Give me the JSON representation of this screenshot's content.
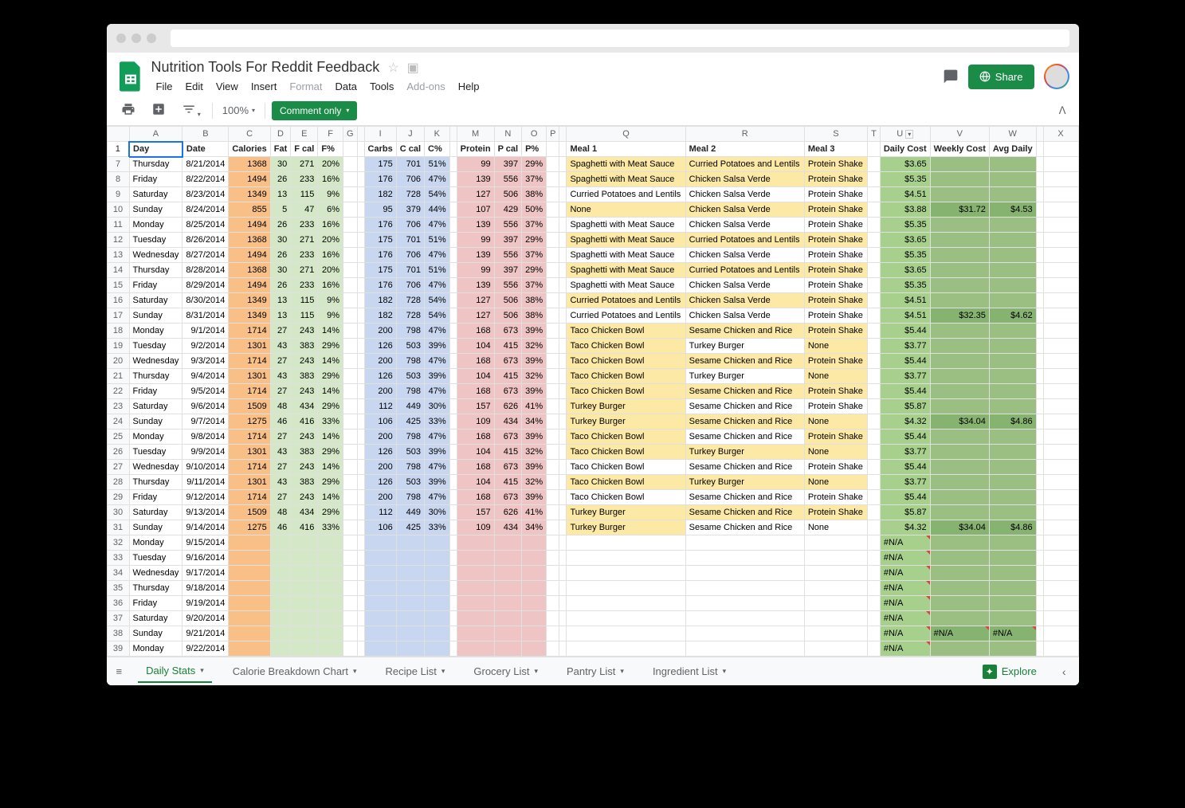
{
  "doc_title": "Nutrition Tools For Reddit Feedback",
  "menus": [
    "File",
    "Edit",
    "View",
    "Insert",
    "Format",
    "Data",
    "Tools",
    "Add-ons",
    "Help"
  ],
  "menu_disabled": [
    "Format",
    "Add-ons"
  ],
  "share_label": "Share",
  "zoom": "100%",
  "comment_mode": "Comment only",
  "columns_letters": [
    "A",
    "B",
    "C",
    "D",
    "E",
    "F",
    "G",
    "",
    "I",
    "J",
    "K",
    "",
    "M",
    "N",
    "O",
    "P",
    "",
    "Q",
    "R",
    "S",
    "T",
    "U",
    "V",
    "W",
    "",
    "X"
  ],
  "column_dropdown_idx": 21,
  "headers": [
    "Day",
    "Date",
    "Calories",
    "Fat",
    "F cal",
    "F%",
    "",
    "Carbs",
    "C cal",
    "C%",
    "",
    "Protein",
    "P cal",
    "P%",
    "",
    "Meal 1",
    "Meal 2",
    "Meal 3",
    "",
    "Daily Cost",
    "Weekly Cost",
    "Avg Daily",
    "",
    ""
  ],
  "first_row_num": 7,
  "rows": [
    {
      "n": 7,
      "day": "Thursday",
      "date": "8/21/2014",
      "cal": 1368,
      "fat": 30,
      "fcal": 271,
      "fp": "20%",
      "carb": 175,
      "ccal": 701,
      "cp": "51%",
      "pro": 99,
      "pcal": 397,
      "pp": "29%",
      "m1": "Spaghetti with Meat Sauce",
      "m2": "Curried Potatoes and Lentils",
      "m3": "Protein Shake",
      "dc": "$3.65",
      "wc": "",
      "avg": "",
      "h1": "y",
      "h2": "y",
      "h3": "y",
      "hc": ""
    },
    {
      "n": 8,
      "day": "Friday",
      "date": "8/22/2014",
      "cal": 1494,
      "fat": 26,
      "fcal": 233,
      "fp": "16%",
      "carb": 176,
      "ccal": 706,
      "cp": "47%",
      "pro": 139,
      "pcal": 556,
      "pp": "37%",
      "m1": "Spaghetti with Meat Sauce",
      "m2": "Chicken Salsa Verde",
      "m3": "Protein Shake",
      "dc": "$5.35",
      "wc": "",
      "avg": "",
      "h1": "y",
      "h2": "y",
      "h3": "y",
      "hc": ""
    },
    {
      "n": 9,
      "day": "Saturday",
      "date": "8/23/2014",
      "cal": 1349,
      "fat": 13,
      "fcal": 115,
      "fp": "9%",
      "carb": 182,
      "ccal": 728,
      "cp": "54%",
      "pro": 127,
      "pcal": 506,
      "pp": "38%",
      "m1": "Curried Potatoes and Lentils",
      "m2": "Chicken Salsa Verde",
      "m3": "Protein Shake",
      "dc": "$4.51",
      "wc": "",
      "avg": "",
      "h1": "",
      "h2": "",
      "h3": "",
      "hc": ""
    },
    {
      "n": 10,
      "day": "Sunday",
      "date": "8/24/2014",
      "cal": 855,
      "fat": 5,
      "fcal": 47,
      "fp": "6%",
      "carb": 95,
      "ccal": 379,
      "cp": "44%",
      "pro": 107,
      "pcal": 429,
      "pp": "50%",
      "m1": "None",
      "m2": "Chicken Salsa Verde",
      "m3": "Protein Shake",
      "dc": "$3.88",
      "wc": "$31.72",
      "avg": "$4.53",
      "h1": "y",
      "h2": "y",
      "h3": "y",
      "hc": "y"
    },
    {
      "n": 11,
      "day": "Monday",
      "date": "8/25/2014",
      "cal": 1494,
      "fat": 26,
      "fcal": 233,
      "fp": "16%",
      "carb": 176,
      "ccal": 706,
      "cp": "47%",
      "pro": 139,
      "pcal": 556,
      "pp": "37%",
      "m1": "Spaghetti with Meat Sauce",
      "m2": "Chicken Salsa Verde",
      "m3": "Protein Shake",
      "dc": "$5.35",
      "wc": "",
      "avg": "",
      "h1": "",
      "h2": "",
      "h3": "",
      "hc": ""
    },
    {
      "n": 12,
      "day": "Tuesday",
      "date": "8/26/2014",
      "cal": 1368,
      "fat": 30,
      "fcal": 271,
      "fp": "20%",
      "carb": 175,
      "ccal": 701,
      "cp": "51%",
      "pro": 99,
      "pcal": 397,
      "pp": "29%",
      "m1": "Spaghetti with Meat Sauce",
      "m2": "Curried Potatoes and Lentils",
      "m3": "Protein Shake",
      "dc": "$3.65",
      "wc": "",
      "avg": "",
      "h1": "y",
      "h2": "y",
      "h3": "y",
      "hc": ""
    },
    {
      "n": 13,
      "day": "Wednesday",
      "date": "8/27/2014",
      "cal": 1494,
      "fat": 26,
      "fcal": 233,
      "fp": "16%",
      "carb": 176,
      "ccal": 706,
      "cp": "47%",
      "pro": 139,
      "pcal": 556,
      "pp": "37%",
      "m1": "Spaghetti with Meat Sauce",
      "m2": "Chicken Salsa Verde",
      "m3": "Protein Shake",
      "dc": "$5.35",
      "wc": "",
      "avg": "",
      "h1": "",
      "h2": "",
      "h3": "",
      "hc": ""
    },
    {
      "n": 14,
      "day": "Thursday",
      "date": "8/28/2014",
      "cal": 1368,
      "fat": 30,
      "fcal": 271,
      "fp": "20%",
      "carb": 175,
      "ccal": 701,
      "cp": "51%",
      "pro": 99,
      "pcal": 397,
      "pp": "29%",
      "m1": "Spaghetti with Meat Sauce",
      "m2": "Curried Potatoes and Lentils",
      "m3": "Protein Shake",
      "dc": "$3.65",
      "wc": "",
      "avg": "",
      "h1": "y",
      "h2": "y",
      "h3": "y",
      "hc": ""
    },
    {
      "n": 15,
      "day": "Friday",
      "date": "8/29/2014",
      "cal": 1494,
      "fat": 26,
      "fcal": 233,
      "fp": "16%",
      "carb": 176,
      "ccal": 706,
      "cp": "47%",
      "pro": 139,
      "pcal": 556,
      "pp": "37%",
      "m1": "Spaghetti with Meat Sauce",
      "m2": "Chicken Salsa Verde",
      "m3": "Protein Shake",
      "dc": "$5.35",
      "wc": "",
      "avg": "",
      "h1": "",
      "h2": "",
      "h3": "",
      "hc": ""
    },
    {
      "n": 16,
      "day": "Saturday",
      "date": "8/30/2014",
      "cal": 1349,
      "fat": 13,
      "fcal": 115,
      "fp": "9%",
      "carb": 182,
      "ccal": 728,
      "cp": "54%",
      "pro": 127,
      "pcal": 506,
      "pp": "38%",
      "m1": "Curried Potatoes and Lentils",
      "m2": "Chicken Salsa Verde",
      "m3": "Protein Shake",
      "dc": "$4.51",
      "wc": "",
      "avg": "",
      "h1": "y",
      "h2": "y",
      "h3": "y",
      "hc": ""
    },
    {
      "n": 17,
      "day": "Sunday",
      "date": "8/31/2014",
      "cal": 1349,
      "fat": 13,
      "fcal": 115,
      "fp": "9%",
      "carb": 182,
      "ccal": 728,
      "cp": "54%",
      "pro": 127,
      "pcal": 506,
      "pp": "38%",
      "m1": "Curried Potatoes and Lentils",
      "m2": "Chicken Salsa Verde",
      "m3": "Protein Shake",
      "dc": "$4.51",
      "wc": "$32.35",
      "avg": "$4.62",
      "h1": "",
      "h2": "",
      "h3": "",
      "hc": "y"
    },
    {
      "n": 18,
      "day": "Monday",
      "date": "9/1/2014",
      "cal": 1714,
      "fat": 27,
      "fcal": 243,
      "fp": "14%",
      "carb": 200,
      "ccal": 798,
      "cp": "47%",
      "pro": 168,
      "pcal": 673,
      "pp": "39%",
      "m1": "Taco Chicken Bowl",
      "m2": "Sesame Chicken and Rice",
      "m3": "Protein Shake",
      "dc": "$5.44",
      "wc": "",
      "avg": "",
      "h1": "y",
      "h2": "y",
      "h3": "y",
      "hc": ""
    },
    {
      "n": 19,
      "day": "Tuesday",
      "date": "9/2/2014",
      "cal": 1301,
      "fat": 43,
      "fcal": 383,
      "fp": "29%",
      "carb": 126,
      "ccal": 503,
      "cp": "39%",
      "pro": 104,
      "pcal": 415,
      "pp": "32%",
      "m1": "Taco Chicken Bowl",
      "m2": "Turkey Burger",
      "m3": "None",
      "dc": "$3.77",
      "wc": "",
      "avg": "",
      "h1": "y",
      "h2": "",
      "h3": "y",
      "hc": ""
    },
    {
      "n": 20,
      "day": "Wednesday",
      "date": "9/3/2014",
      "cal": 1714,
      "fat": 27,
      "fcal": 243,
      "fp": "14%",
      "carb": 200,
      "ccal": 798,
      "cp": "47%",
      "pro": 168,
      "pcal": 673,
      "pp": "39%",
      "m1": "Taco Chicken Bowl",
      "m2": "Sesame Chicken and Rice",
      "m3": "Protein Shake",
      "dc": "$5.44",
      "wc": "",
      "avg": "",
      "h1": "y",
      "h2": "y",
      "h3": "y",
      "hc": ""
    },
    {
      "n": 21,
      "day": "Thursday",
      "date": "9/4/2014",
      "cal": 1301,
      "fat": 43,
      "fcal": 383,
      "fp": "29%",
      "carb": 126,
      "ccal": 503,
      "cp": "39%",
      "pro": 104,
      "pcal": 415,
      "pp": "32%",
      "m1": "Taco Chicken Bowl",
      "m2": "Turkey Burger",
      "m3": "None",
      "dc": "$3.77",
      "wc": "",
      "avg": "",
      "h1": "y",
      "h2": "",
      "h3": "y",
      "hc": ""
    },
    {
      "n": 22,
      "day": "Friday",
      "date": "9/5/2014",
      "cal": 1714,
      "fat": 27,
      "fcal": 243,
      "fp": "14%",
      "carb": 200,
      "ccal": 798,
      "cp": "47%",
      "pro": 168,
      "pcal": 673,
      "pp": "39%",
      "m1": "Taco Chicken Bowl",
      "m2": "Sesame Chicken and Rice",
      "m3": "Protein Shake",
      "dc": "$5.44",
      "wc": "",
      "avg": "",
      "h1": "y",
      "h2": "y",
      "h3": "y",
      "hc": ""
    },
    {
      "n": 23,
      "day": "Saturday",
      "date": "9/6/2014",
      "cal": 1509,
      "fat": 48,
      "fcal": 434,
      "fp": "29%",
      "carb": 112,
      "ccal": 449,
      "cp": "30%",
      "pro": 157,
      "pcal": 626,
      "pp": "41%",
      "m1": "Turkey Burger",
      "m2": "Sesame Chicken and Rice",
      "m3": "Protein Shake",
      "dc": "$5.87",
      "wc": "",
      "avg": "",
      "h1": "y",
      "h2": "",
      "h3": "",
      "hc": ""
    },
    {
      "n": 24,
      "day": "Sunday",
      "date": "9/7/2014",
      "cal": 1275,
      "fat": 46,
      "fcal": 416,
      "fp": "33%",
      "carb": 106,
      "ccal": 425,
      "cp": "33%",
      "pro": 109,
      "pcal": 434,
      "pp": "34%",
      "m1": "Turkey Burger",
      "m2": "Sesame Chicken and Rice",
      "m3": "None",
      "dc": "$4.32",
      "wc": "$34.04",
      "avg": "$4.86",
      "h1": "y",
      "h2": "y",
      "h3": "y",
      "hc": "y"
    },
    {
      "n": 25,
      "day": "Monday",
      "date": "9/8/2014",
      "cal": 1714,
      "fat": 27,
      "fcal": 243,
      "fp": "14%",
      "carb": 200,
      "ccal": 798,
      "cp": "47%",
      "pro": 168,
      "pcal": 673,
      "pp": "39%",
      "m1": "Taco Chicken Bowl",
      "m2": "Sesame Chicken and Rice",
      "m3": "Protein Shake",
      "dc": "$5.44",
      "wc": "",
      "avg": "",
      "h1": "y",
      "h2": "",
      "h3": "y",
      "hc": ""
    },
    {
      "n": 26,
      "day": "Tuesday",
      "date": "9/9/2014",
      "cal": 1301,
      "fat": 43,
      "fcal": 383,
      "fp": "29%",
      "carb": 126,
      "ccal": 503,
      "cp": "39%",
      "pro": 104,
      "pcal": 415,
      "pp": "32%",
      "m1": "Taco Chicken Bowl",
      "m2": "Turkey Burger",
      "m3": "None",
      "dc": "$3.77",
      "wc": "",
      "avg": "",
      "h1": "y",
      "h2": "y",
      "h3": "y",
      "hc": ""
    },
    {
      "n": 27,
      "day": "Wednesday",
      "date": "9/10/2014",
      "cal": 1714,
      "fat": 27,
      "fcal": 243,
      "fp": "14%",
      "carb": 200,
      "ccal": 798,
      "cp": "47%",
      "pro": 168,
      "pcal": 673,
      "pp": "39%",
      "m1": "Taco Chicken Bowl",
      "m2": "Sesame Chicken and Rice",
      "m3": "Protein Shake",
      "dc": "$5.44",
      "wc": "",
      "avg": "",
      "h1": "",
      "h2": "",
      "h3": "",
      "hc": ""
    },
    {
      "n": 28,
      "day": "Thursday",
      "date": "9/11/2014",
      "cal": 1301,
      "fat": 43,
      "fcal": 383,
      "fp": "29%",
      "carb": 126,
      "ccal": 503,
      "cp": "39%",
      "pro": 104,
      "pcal": 415,
      "pp": "32%",
      "m1": "Taco Chicken Bowl",
      "m2": "Turkey Burger",
      "m3": "None",
      "dc": "$3.77",
      "wc": "",
      "avg": "",
      "h1": "y",
      "h2": "y",
      "h3": "y",
      "hc": ""
    },
    {
      "n": 29,
      "day": "Friday",
      "date": "9/12/2014",
      "cal": 1714,
      "fat": 27,
      "fcal": 243,
      "fp": "14%",
      "carb": 200,
      "ccal": 798,
      "cp": "47%",
      "pro": 168,
      "pcal": 673,
      "pp": "39%",
      "m1": "Taco Chicken Bowl",
      "m2": "Sesame Chicken and Rice",
      "m3": "Protein Shake",
      "dc": "$5.44",
      "wc": "",
      "avg": "",
      "h1": "",
      "h2": "",
      "h3": "",
      "hc": ""
    },
    {
      "n": 30,
      "day": "Saturday",
      "date": "9/13/2014",
      "cal": 1509,
      "fat": 48,
      "fcal": 434,
      "fp": "29%",
      "carb": 112,
      "ccal": 449,
      "cp": "30%",
      "pro": 157,
      "pcal": 626,
      "pp": "41%",
      "m1": "Turkey Burger",
      "m2": "Sesame Chicken and Rice",
      "m3": "Protein Shake",
      "dc": "$5.87",
      "wc": "",
      "avg": "",
      "h1": "y",
      "h2": "y",
      "h3": "y",
      "hc": ""
    },
    {
      "n": 31,
      "day": "Sunday",
      "date": "9/14/2014",
      "cal": 1275,
      "fat": 46,
      "fcal": 416,
      "fp": "33%",
      "carb": 106,
      "ccal": 425,
      "cp": "33%",
      "pro": 109,
      "pcal": 434,
      "pp": "34%",
      "m1": "Turkey Burger",
      "m2": "Sesame Chicken and Rice",
      "m3": "None",
      "dc": "$4.32",
      "wc": "$34.04",
      "avg": "$4.86",
      "h1": "y",
      "h2": "",
      "h3": "",
      "hc": "y"
    },
    {
      "n": 32,
      "day": "Monday",
      "date": "9/15/2014",
      "dc": "#N/A"
    },
    {
      "n": 33,
      "day": "Tuesday",
      "date": "9/16/2014",
      "dc": "#N/A"
    },
    {
      "n": 34,
      "day": "Wednesday",
      "date": "9/17/2014",
      "dc": "#N/A"
    },
    {
      "n": 35,
      "day": "Thursday",
      "date": "9/18/2014",
      "dc": "#N/A"
    },
    {
      "n": 36,
      "day": "Friday",
      "date": "9/19/2014",
      "dc": "#N/A"
    },
    {
      "n": 37,
      "day": "Saturday",
      "date": "9/20/2014",
      "dc": "#N/A"
    },
    {
      "n": 38,
      "day": "Sunday",
      "date": "9/21/2014",
      "dc": "#N/A",
      "wc": "#N/A",
      "avg": "#N/A"
    },
    {
      "n": 39,
      "day": "Monday",
      "date": "9/22/2014",
      "dc": "#N/A"
    }
  ],
  "tabs": [
    "Daily Stats",
    "Calorie Breakdown Chart",
    "Recipe List",
    "Grocery List",
    "Pantry List",
    "Ingredient List"
  ],
  "active_tab": 0,
  "explore_label": "Explore",
  "colors": {
    "cal_bg": "#f8c087",
    "fat_bg": "#d4e8c7",
    "carb_bg": "#c8d7ef",
    "pro_bg": "#efc4c4",
    "meal_bg": "#fde9a6",
    "cost_bg": "#a8d08d",
    "cost_bg2": "#9bbf82",
    "cost_dark": "#87b370",
    "sep_bg": "#ffffff"
  }
}
